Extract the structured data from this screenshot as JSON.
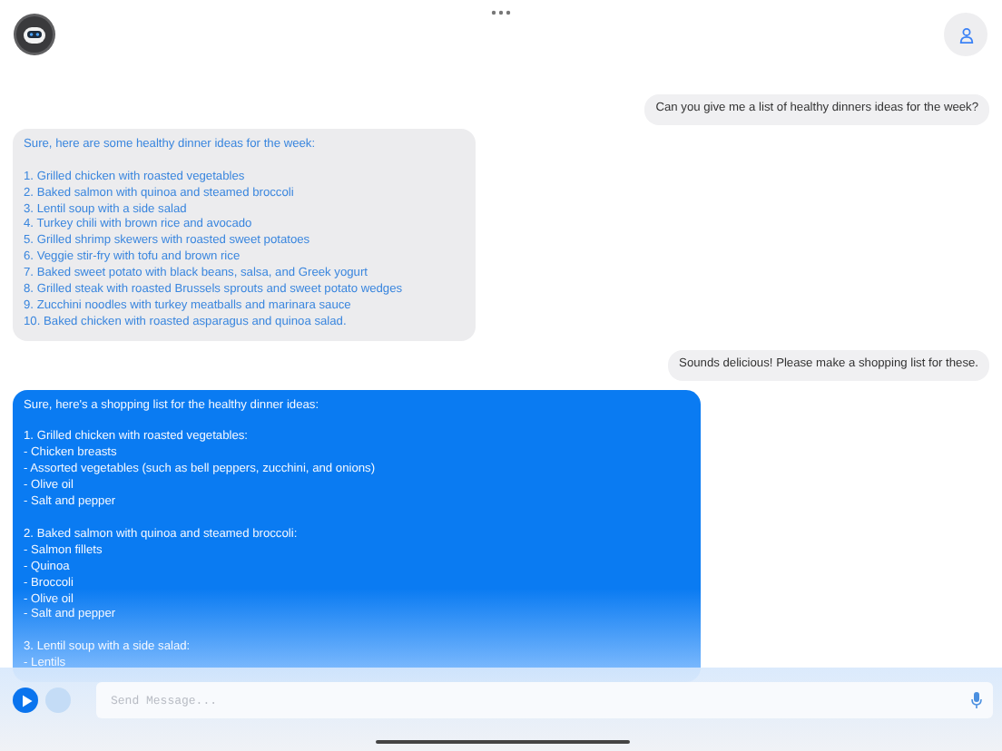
{
  "input": {
    "placeholder": "Send Message..."
  },
  "messages": [
    {
      "kind": "user",
      "paragraphs": [
        [
          "Can you give me a list of healthy dinners ideas for the week?"
        ]
      ]
    },
    {
      "kind": "assistant",
      "paragraphs": [
        [
          "Sure, here are some healthy dinner ideas for the week:"
        ],
        [
          "1. Grilled chicken with roasted vegetables",
          "2. Baked salmon with quinoa and steamed broccoli",
          "3. Lentil soup with a side salad",
          "4. Turkey chili with brown rice and avocado",
          "5. Grilled shrimp skewers with roasted sweet potatoes",
          "6. Veggie stir-fry with tofu and brown rice",
          "7. Baked sweet potato with black beans, salsa, and Greek yogurt",
          "8. Grilled steak with roasted Brussels sprouts and sweet potato wedges",
          "9. Zucchini noodles with turkey meatballs and marinara sauce",
          "10. Baked chicken with roasted asparagus and quinoa salad."
        ]
      ]
    },
    {
      "kind": "user",
      "paragraphs": [
        [
          "Sounds delicious! Please make a shopping list for these."
        ]
      ]
    },
    {
      "kind": "streaming",
      "paragraphs": [
        [
          "Sure, here's a shopping list for the healthy dinner ideas:"
        ],
        [
          "1. Grilled chicken with roasted vegetables:",
          "- Chicken breasts",
          "- Assorted vegetables (such as bell peppers, zucchini, and onions)",
          "- Olive oil",
          "- Salt and pepper"
        ],
        [
          "2. Baked salmon with quinoa and steamed broccoli:",
          "- Salmon fillets",
          "- Quinoa",
          "- Broccoli",
          "- Olive oil",
          "- Salt and pepper"
        ],
        [
          "3. Lentil soup with a side salad:",
          "- Lentils"
        ]
      ]
    }
  ]
}
